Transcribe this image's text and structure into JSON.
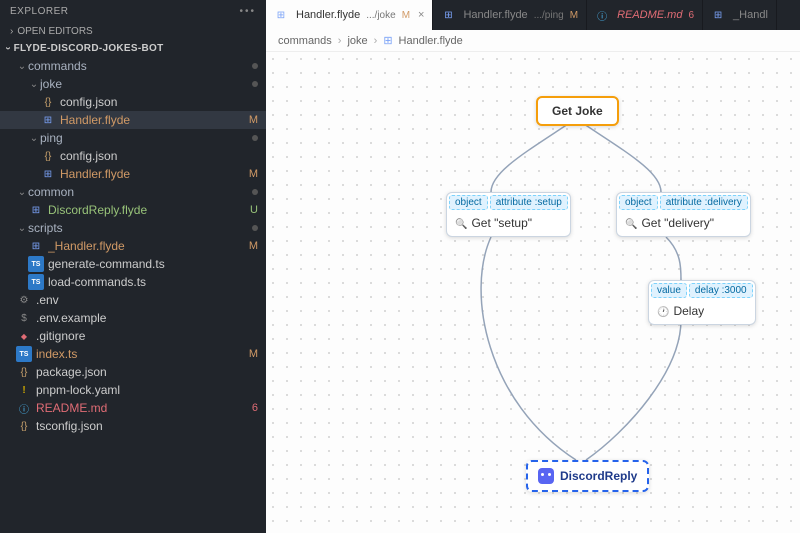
{
  "sidebar": {
    "title": "EXPLORER",
    "open_editors": "OPEN EDITORS",
    "project": "FLYDE-DISCORD-JOKES-BOT",
    "tree": [
      {
        "type": "folder",
        "name": "commands",
        "indent": 1,
        "open": true,
        "mod": true,
        "dot": true
      },
      {
        "type": "folder",
        "name": "joke",
        "indent": 2,
        "open": true,
        "mod": true,
        "dot": true
      },
      {
        "type": "file",
        "name": "config.json",
        "indent": 3,
        "icon": "json"
      },
      {
        "type": "file",
        "name": "Handler.flyde",
        "indent": 3,
        "icon": "flyde",
        "mod": true,
        "badge": "M",
        "active": true
      },
      {
        "type": "folder",
        "name": "ping",
        "indent": 2,
        "open": true,
        "mod": true,
        "dot": true
      },
      {
        "type": "file",
        "name": "config.json",
        "indent": 3,
        "icon": "json"
      },
      {
        "type": "file",
        "name": "Handler.flyde",
        "indent": 3,
        "icon": "flyde",
        "mod": true,
        "badge": "M"
      },
      {
        "type": "folder",
        "name": "common",
        "indent": 1,
        "open": true,
        "untracked": true,
        "dot": true
      },
      {
        "type": "file",
        "name": "DiscordReply.flyde",
        "indent": 2,
        "icon": "flyde",
        "untracked": true,
        "badge": "U"
      },
      {
        "type": "folder",
        "name": "scripts",
        "indent": 1,
        "open": true,
        "mod": true,
        "dot": true
      },
      {
        "type": "file",
        "name": "_Handler.flyde",
        "indent": 2,
        "icon": "flyde",
        "mod": true,
        "badge": "M"
      },
      {
        "type": "file",
        "name": "generate-command.ts",
        "indent": 2,
        "icon": "ts"
      },
      {
        "type": "file",
        "name": "load-commands.ts",
        "indent": 2,
        "icon": "ts"
      },
      {
        "type": "file",
        "name": ".env",
        "indent": 1,
        "icon": "gear"
      },
      {
        "type": "file",
        "name": ".env.example",
        "indent": 1,
        "icon": "dollar"
      },
      {
        "type": "file",
        "name": ".gitignore",
        "indent": 1,
        "icon": "git"
      },
      {
        "type": "file",
        "name": "index.ts",
        "indent": 1,
        "icon": "ts",
        "mod": true,
        "badge": "M"
      },
      {
        "type": "file",
        "name": "package.json",
        "indent": 1,
        "icon": "json"
      },
      {
        "type": "file",
        "name": "pnpm-lock.yaml",
        "indent": 1,
        "icon": "excl"
      },
      {
        "type": "file",
        "name": "README.md",
        "indent": 1,
        "icon": "info",
        "err": true,
        "badge": "6"
      },
      {
        "type": "file",
        "name": "tsconfig.json",
        "indent": 1,
        "icon": "json"
      }
    ]
  },
  "tabs": [
    {
      "icon": "flyde",
      "name": "Handler.flyde",
      "path": ".../joke",
      "badge": "M",
      "active": true,
      "close": true
    },
    {
      "icon": "flyde",
      "name": "Handler.flyde",
      "path": ".../ping",
      "badge": "M"
    },
    {
      "icon": "info",
      "name": "README.md",
      "badge_num": "6",
      "readme": true
    },
    {
      "icon": "flyde",
      "name": "_Handl"
    }
  ],
  "breadcrumb": [
    "commands",
    "joke",
    "Handler.flyde"
  ],
  "nodes": {
    "getjoke": "Get Joke",
    "setup": {
      "pins": [
        "object",
        "attribute :setup"
      ],
      "label": "Get \"setup\""
    },
    "delivery": {
      "pins": [
        "object",
        "attribute :delivery"
      ],
      "label": "Get \"delivery\""
    },
    "delay": {
      "pins": [
        "value",
        "delay :3000"
      ],
      "label": "Delay"
    },
    "discord": "DiscordReply"
  }
}
